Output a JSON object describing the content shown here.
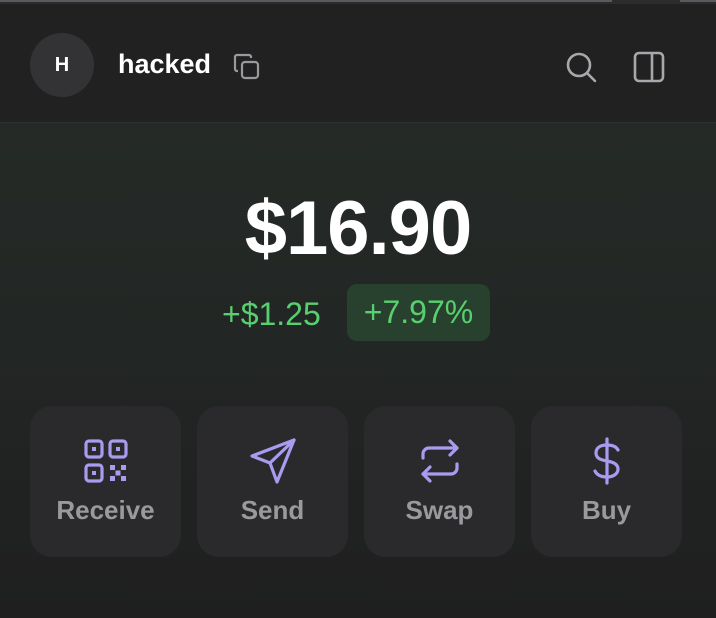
{
  "header": {
    "avatar_initial": "H",
    "account_name": "hacked"
  },
  "balance": {
    "total": "$16.90",
    "change_amount": "+$1.25",
    "change_percent": "+7.97%"
  },
  "actions": [
    {
      "label": "Receive",
      "icon": "qr-code-icon"
    },
    {
      "label": "Send",
      "icon": "paper-plane-icon"
    },
    {
      "label": "Swap",
      "icon": "swap-arrows-icon"
    },
    {
      "label": "Buy",
      "icon": "dollar-icon"
    }
  ],
  "colors": {
    "accent_purple": "#a99bf0",
    "positive_green": "#58d06f",
    "positive_bg": "#27412e",
    "button_bg": "#2a2a2c"
  }
}
